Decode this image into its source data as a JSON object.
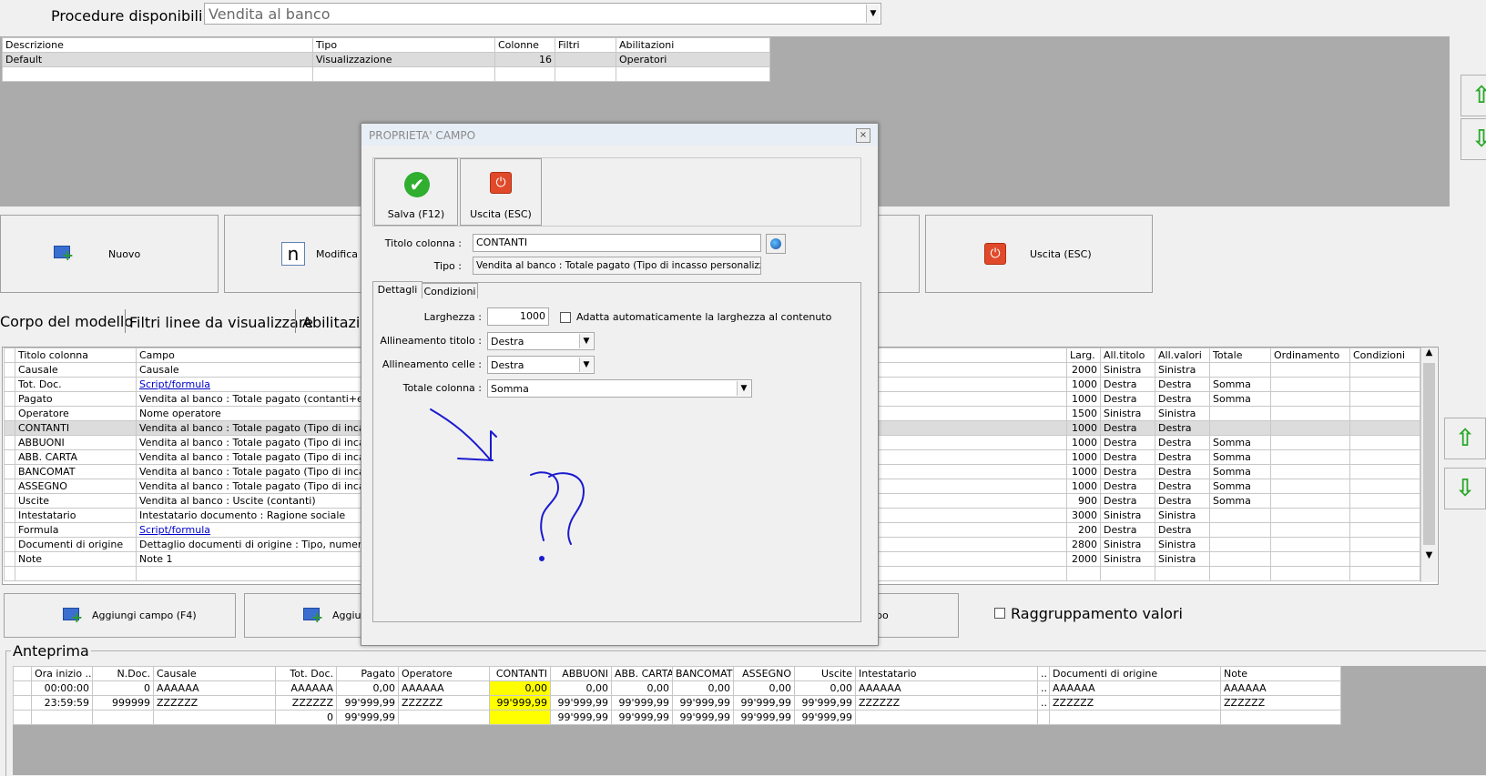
{
  "header": {
    "procedures_label": "Procedure disponibili :",
    "procedures_value": "Vendita al banco"
  },
  "top_grid": {
    "columns": [
      "Descrizione",
      "Tipo",
      "Colonne",
      "Filtri",
      "Abilitazioni"
    ],
    "rows": [
      [
        "Default",
        "Visualizzazione",
        "16",
        "",
        "Operatori"
      ],
      [
        "",
        "",
        "",
        "",
        ""
      ]
    ]
  },
  "buttons": {
    "nuovo": "Nuovo",
    "modifica": "Modifica",
    "modifica_icon_letter": "n",
    "uscita": "Uscita (ESC)",
    "aggiungi_campo": "Aggiungi campo (F4)",
    "aggiungi2": "Aggiu",
    "hidden_btn_tail": "po"
  },
  "tabs": [
    "Corpo del modello",
    "Filtri linee da visualizzare",
    "Abilitazio"
  ],
  "main_grid": {
    "columns": [
      "Titolo colonna",
      "Campo",
      "Larg.",
      "All.titolo",
      "All.valori",
      "Totale",
      "Ordinamento",
      "Condizioni"
    ],
    "rows": [
      [
        "Causale",
        "Causale",
        "2000",
        "Sinistra",
        "Sinistra",
        "",
        "",
        ""
      ],
      [
        "Tot. Doc.",
        "Script/formula",
        "1000",
        "Destra",
        "Destra",
        "Somma",
        "",
        ""
      ],
      [
        "Pagato",
        "Vendita al banco : Totale pagato (contanti+effetti+...",
        "1000",
        "Destra",
        "Destra",
        "Somma",
        "",
        ""
      ],
      [
        "Operatore",
        "Nome operatore",
        "1500",
        "Sinistra",
        "Sinistra",
        "",
        "",
        ""
      ],
      [
        "CONTANTI",
        "Vendita al banco : Totale pagato (Tipo di incasso pe",
        "1000",
        "Destra",
        "Destra",
        "",
        "",
        ""
      ],
      [
        "ABBUONI",
        "Vendita al banco : Totale pagato (Tipo di incasso pe",
        "1000",
        "Destra",
        "Destra",
        "Somma",
        "",
        ""
      ],
      [
        "ABB. CARTA",
        "Vendita al banco : Totale pagato (Tipo di incasso pe",
        "1000",
        "Destra",
        "Destra",
        "Somma",
        "",
        ""
      ],
      [
        "BANCOMAT",
        "Vendita al banco : Totale pagato (Tipo di incasso pe",
        "1000",
        "Destra",
        "Destra",
        "Somma",
        "",
        ""
      ],
      [
        "ASSEGNO",
        "Vendita al banco : Totale pagato (Tipo di incasso pe",
        "1000",
        "Destra",
        "Destra",
        "Somma",
        "",
        ""
      ],
      [
        "Uscite",
        "Vendita al banco : Uscite (contanti)",
        "900",
        "Destra",
        "Destra",
        "Somma",
        "",
        ""
      ],
      [
        "Intestatario",
        "Intestatario documento : Ragione sociale",
        "3000",
        "Sinistra",
        "Sinistra",
        "",
        "",
        ""
      ],
      [
        "Formula",
        "Script/formula",
        "200",
        "Destra",
        "Destra",
        "",
        "",
        ""
      ],
      [
        "Documenti di origine",
        "Dettaglio documenti di origine : Tipo, numero e data",
        "2800",
        "Sinistra",
        "Sinistra",
        "",
        "",
        ""
      ],
      [
        "Note",
        "Note 1",
        "2000",
        "Sinistra",
        "Sinistra",
        "",
        "",
        ""
      ]
    ]
  },
  "raggruppamento_label": "Raggruppamento valori",
  "preview": {
    "label": "Anteprima",
    "columns": [
      "Ora inizio ...",
      "N.Doc.",
      "Causale",
      "Tot. Doc.",
      "Pagato",
      "Operatore",
      "CONTANTI",
      "ABBUONI",
      "ABB. CARTA",
      "BANCOMAT",
      "ASSEGNO",
      "Uscite",
      "Intestatario",
      "..",
      "Documenti di origine",
      "Note"
    ],
    "rows": [
      [
        "00:00:00",
        "0",
        "AAAAAA",
        "AAAAAA",
        "0,00",
        "AAAAAA",
        "0,00",
        "0,00",
        "0,00",
        "0,00",
        "0,00",
        "0,00",
        "AAAAAA",
        "..",
        "AAAAAA",
        "AAAAAA"
      ],
      [
        "23:59:59",
        "999999",
        "ZZZZZZ",
        "ZZZZZZ",
        "99'999,99",
        "ZZZZZZ",
        "99'999,99",
        "99'999,99",
        "99'999,99",
        "99'999,99",
        "99'999,99",
        "99'999,99",
        "ZZZZZZ",
        "..",
        "ZZZZZZ",
        "ZZZZZZ"
      ],
      [
        "",
        "",
        "",
        "0",
        "99'999,99",
        "",
        "",
        "99'999,99",
        "99'999,99",
        "99'999,99",
        "99'999,99",
        "99'999,99",
        "",
        "",
        "",
        ""
      ]
    ]
  },
  "dialog": {
    "title": "PROPRIETA' CAMPO",
    "save_label": "Salva (F12)",
    "exit_label": "Uscita (ESC)",
    "titolo_label": "Titolo colonna :",
    "titolo_value": "CONTANTI",
    "tipo_label": "Tipo :",
    "tipo_value": "Vendita al banco : Totale pagato (Tipo di incasso personalizzato)",
    "tabs": [
      "Dettagli",
      "Condizioni"
    ],
    "larghezza_label": "Larghezza :",
    "larghezza_value": "1000",
    "adatta_label": "Adatta automaticamente la larghezza al contenuto",
    "all_titolo_label": "Allineamento titolo :",
    "all_titolo_value": "Destra",
    "all_celle_label": "Allineamento celle :",
    "all_celle_value": "Destra",
    "totale_label": "Totale colonna :",
    "totale_value": "Somma"
  },
  "colors": {
    "highlight_yellow": "#ffff00",
    "link_blue": "#0000cc",
    "annotation_blue": "#1a1ad0"
  }
}
